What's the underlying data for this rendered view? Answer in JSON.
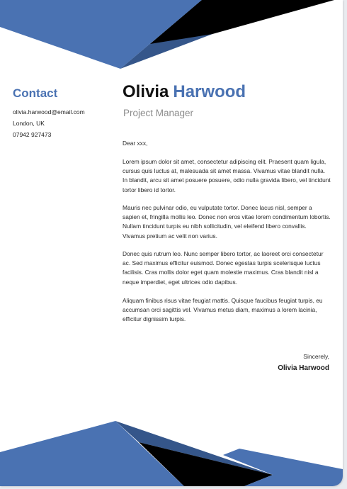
{
  "contact": {
    "heading": "Contact",
    "email": "olivia.harwood@email.com",
    "location": "London, UK",
    "phone": "07942 927473"
  },
  "header": {
    "first_name": "Olivia",
    "last_name": "Harwood",
    "role": "Project Manager"
  },
  "letter": {
    "salutation": "Dear xxx,",
    "paragraphs": [
      "Lorem ipsum dolor sit amet, consectetur adipiscing elit. Praesent quam ligula, cursus quis luctus at, malesuada sit amet massa. Vivamus vitae blandit nulla. In blandit, arcu sit amet posuere posuere, odio nulla gravida libero, vel tincidunt tortor libero id tortor.",
      "Mauris nec pulvinar odio, eu vulputate tortor. Donec lacus nisl, semper a sapien et, fringilla mollis leo. Donec non eros vitae lorem condimentum lobortis. Nullam tincidunt turpis eu nibh sollicitudin, vel eleifend libero convallis. Vivamus pretium ac velit non varius.",
      "Donec quis rutrum leo. Nunc semper libero tortor, ac laoreet orci consectetur ac. Sed maximus efficitur euismod. Donec egestas turpis scelerisque luctus facilisis. Cras mollis dolor eget quam molestie maximus. Cras blandit nisl a neque imperdiet, eget ultrices odio dapibus.",
      "Aliquam finibus risus vitae feugiat mattis. Quisque faucibus feugiat turpis, eu accumsan orci sagittis vel. Vivamus metus diam, maximus a lorem lacinia, efficitur dignissim turpis."
    ],
    "signoff": "Sincerely,",
    "signature": "Olivia Harwood"
  },
  "colors": {
    "accent": "#4a72b2",
    "accent_dark": "#35568a",
    "dark": "#000000",
    "page": "#ffffff",
    "background": "#e9ebef"
  }
}
